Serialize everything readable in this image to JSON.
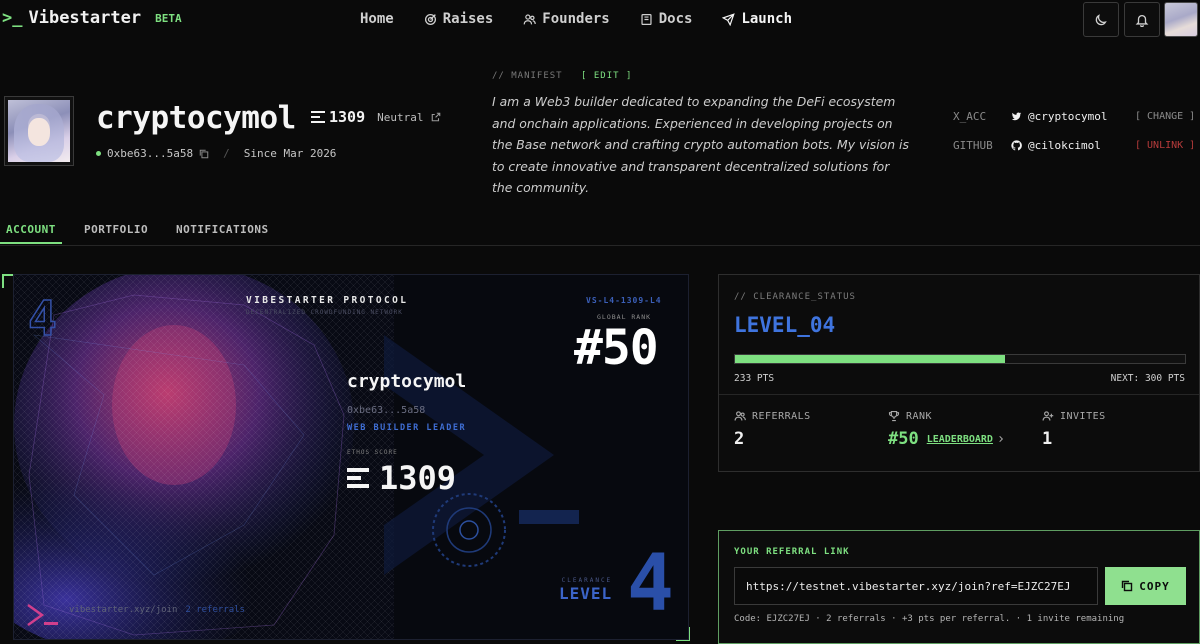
{
  "nav": {
    "logo_mark": ">_",
    "logo_text": "Vibestarter",
    "beta": "BETA",
    "links": [
      {
        "label": "Home",
        "icon": "none"
      },
      {
        "label": "Raises",
        "icon": "target-icon"
      },
      {
        "label": "Founders",
        "icon": "users-icon"
      },
      {
        "label": "Docs",
        "icon": "book-icon"
      },
      {
        "label": "Launch",
        "icon": "send-icon"
      }
    ],
    "buttons": [
      "moon-icon",
      "bell-icon"
    ]
  },
  "profile": {
    "username": "cryptocymol",
    "ethos_score": "1309",
    "reputation": "Neutral",
    "wallet": "0xbe63...5a58",
    "since": "Since Mar 2026"
  },
  "manifest": {
    "label": "// MANIFEST",
    "edit": "[ EDIT ]",
    "text": "I am a Web3 builder dedicated to expanding the DeFi ecosystem and onchain applications. Experienced in developing projects on the Base network and crafting crypto automation bots. My vision is to create innovative and transparent decentralized solutions for the community."
  },
  "socials": [
    {
      "key": "X_ACC",
      "icon": "twitter-icon",
      "handle": "@cryptocymol",
      "action": "[ CHANGE ]"
    },
    {
      "key": "GITHUB",
      "icon": "github-icon",
      "handle": "@cilokcimol",
      "action": "[ UNLINK ]"
    }
  ],
  "tabs": [
    "ACCOUNT",
    "PORTFOLIO",
    "NOTIFICATIONS"
  ],
  "card": {
    "title": "VIBESTARTER PROTOCOL",
    "subtitle": "DECENTRALIZED CROWDFUNDING NETWORK",
    "code": "VS-L4-1309-L4",
    "rank_label": "GLOBAL RANK",
    "rank": "#50",
    "username": "cryptocymol",
    "wallet": "0xbe63...5a58",
    "role": "WEB BUILDER LEADER",
    "ethos_label": "ETHOS SCORE",
    "ethos": "1309",
    "footer_url": "vibestarter.xyz/join",
    "footer_ref": "2 referrals",
    "clearance_label": "CLEARANCE",
    "clearance_level": "LEVEL",
    "big_level": "4",
    "corner_level": "4"
  },
  "clearance": {
    "label": "// CLEARANCE_STATUS",
    "level": "LEVEL_04",
    "progress": 0.6,
    "pts": "233 PTS",
    "next": "NEXT: 300 PTS",
    "stats": [
      {
        "label": "REFERRALS",
        "icon": "users-icon",
        "value": "2"
      },
      {
        "label": "RANK",
        "icon": "trophy-icon",
        "value": "#50",
        "link": "LEADERBOARD"
      },
      {
        "label": "INVITES",
        "icon": "user-plus-icon",
        "value": "1"
      }
    ]
  },
  "referral": {
    "label": "YOUR REFERRAL LINK",
    "url": "https://testnet.vibestarter.xyz/join?ref=EJZC27EJ",
    "copy": "COPY",
    "meta": "Code: EJZC27EJ · 2 referrals · +3 pts per referral. · 1 invite remaining"
  },
  "colors": {
    "accent": "#7ee081",
    "level_blue": "#3f74de",
    "danger": "#b53b3b",
    "bg": "#0a0a0a"
  }
}
